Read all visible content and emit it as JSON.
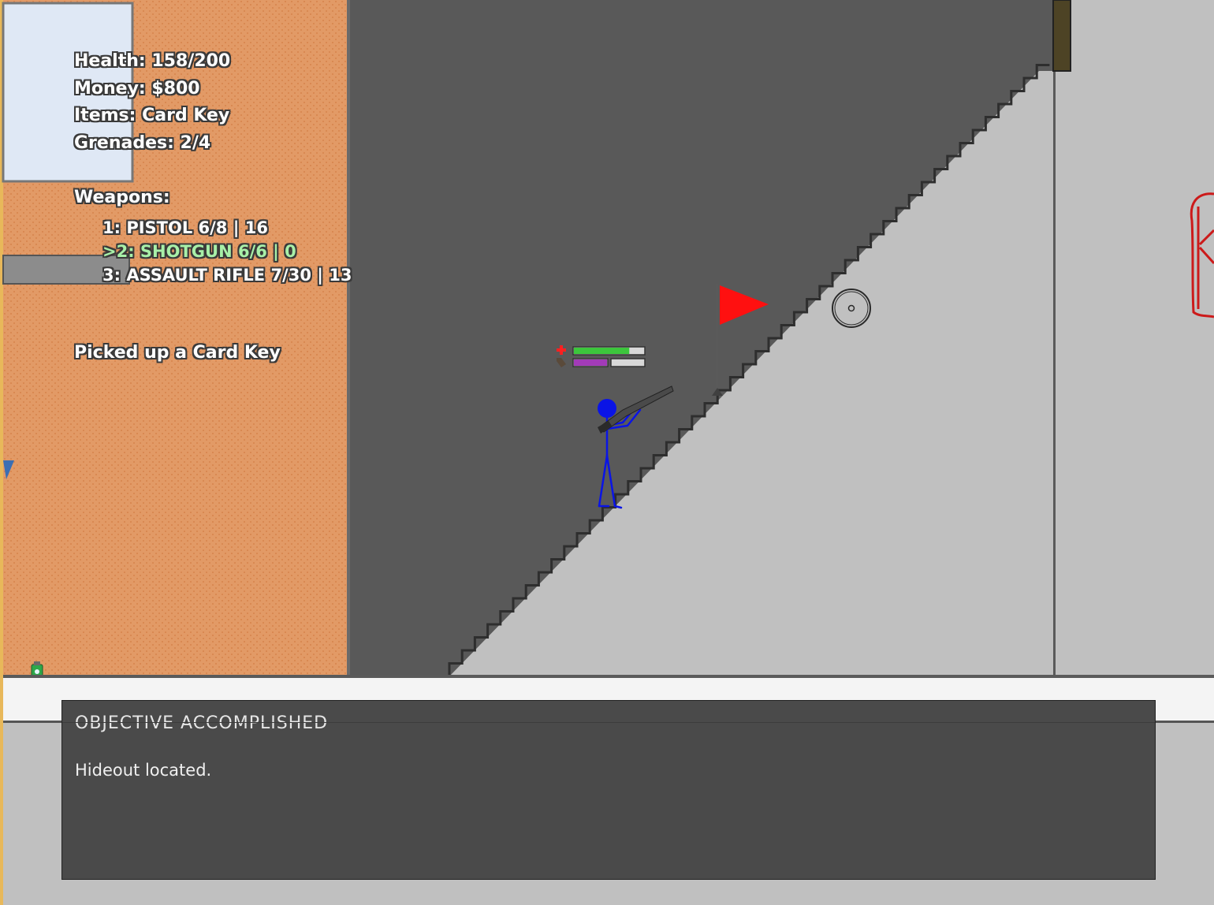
{
  "hud": {
    "health": "Health: 158/200",
    "money": "Money: $800",
    "items": "Items: Card Key",
    "grenades": "Grenades: 2/4",
    "weapons_heading": "Weapons:",
    "weapons": [
      {
        "label": "1: PISTOL 6/8 | 16",
        "active": false
      },
      {
        "label": ">2: SHOTGUN 6/6 | 0",
        "active": true
      },
      {
        "label": "3: ASSAULT RIFLE 7/30 | 13",
        "active": false
      }
    ],
    "pickup_message": "Picked up a Card Key"
  },
  "objective": {
    "title": "OBJECTIVE ACCOMPLISHED",
    "message": "Hideout located."
  },
  "player": {
    "health_fraction": 0.79,
    "ammo_fraction": 0.5
  },
  "colors": {
    "brick": "#e29a66",
    "dark_wall": "#595959",
    "light_wall": "#c0c0c0",
    "player": "#0a14e6",
    "flag": "#ff1010",
    "health_bar": "#3cc63c",
    "ammo_bar": "#a23bb8"
  }
}
